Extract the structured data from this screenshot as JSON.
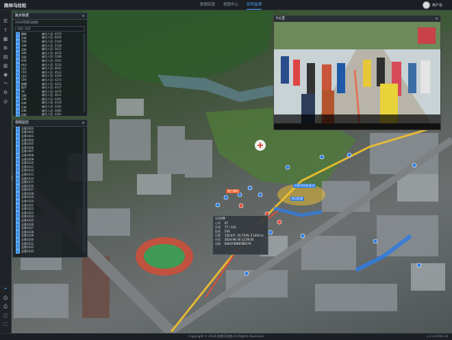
{
  "app": {
    "title": "跑林马拉松"
  },
  "nav": {
    "items": [
      "数据底图",
      "视图中心",
      "实时监测"
    ],
    "active_index": 2
  },
  "user": {
    "name": "用户名"
  },
  "left_toolbar": {
    "icons": [
      "layers-icon",
      "upload-icon",
      "grid-icon",
      "map-icon",
      "doc-icon",
      "chart-icon",
      "camera-icon",
      "route-icon",
      "settings-icon",
      "target-icon"
    ]
  },
  "runner_panel": {
    "title": "跑步数据",
    "subtitle": "2024年跑马拉松",
    "filter_placeholder": "请输入搜索",
    "rows": [
      {
        "name": "最新",
        "value": "编号人员: 4379"
      },
      {
        "name": "24K",
        "value": "编号人员: 6456"
      },
      {
        "name": "15K",
        "value": "编号人员: 2104"
      },
      {
        "name": "10K",
        "value": "编号人员: 3128"
      },
      {
        "name": "20K",
        "value": "编号人员: 3411"
      },
      {
        "name": "30K",
        "value": "编号人员: 4476"
      },
      {
        "name": "35K",
        "value": "编号人员: 1288"
      },
      {
        "name": "42K",
        "value": "编号人员: 3602"
      },
      {
        "name": "终点",
        "value": "编号人员: 3214"
      },
      {
        "name": "CP1",
        "value": "编号人员: 4601"
      },
      {
        "name": "CP2",
        "value": "编号人员: 3512"
      },
      {
        "name": "CP3",
        "value": "编号人员: 3329"
      },
      {
        "name": "CP4",
        "value": "编号人员: 4215"
      },
      {
        "name": "新疆",
        "value": "编号人员: 4231"
      },
      {
        "name": "医疗",
        "value": "编号人员: 4317"
      },
      {
        "name": "2K",
        "value": "编号人员: 3476"
      },
      {
        "name": "10K",
        "value": "编号人员: 3011"
      },
      {
        "name": "13K",
        "value": "编号人员: 4301"
      },
      {
        "name": "20K",
        "value": "编号人员: 4318"
      },
      {
        "name": "23K",
        "value": "编号人员: 3305"
      },
      {
        "name": "44K",
        "value": "编号人员: 4480"
      },
      {
        "name": "50K",
        "value": "编号人员: 4391"
      }
    ]
  },
  "camera_panel": {
    "title": "视频监控",
    "rows": [
      "全景1001",
      "全景1002",
      "全景1003",
      "全景1004",
      "全景1005",
      "全景1006",
      "全景1007",
      "全景1008",
      "全景1009",
      "全景1010",
      "全景1011",
      "全景1012",
      "全景1013",
      "全景1014",
      "全景1015",
      "全景1016",
      "全景1017",
      "全景1018",
      "全景1019",
      "全景1020",
      "全景1021",
      "全景1022",
      "全景1023",
      "全景1024",
      "全景1025",
      "全景1026",
      "全景1027",
      "全景1028",
      "全景1029",
      "全景1030",
      "全景1031",
      "全景1032",
      "全景1033"
    ]
  },
  "video_popup": {
    "title": "5公里"
  },
  "info_popup": {
    "title": "12分钟",
    "rows": [
      {
        "key": "心率",
        "value": "97"
      },
      {
        "key": "步频",
        "value": "77 / 131"
      },
      {
        "key": "配速",
        "value": "554"
      },
      {
        "key": "位置",
        "value": "126.63°, 45.7519, 3.1416 m"
      },
      {
        "key": "时间",
        "value": "2024-06-16 12:29:45"
      },
      {
        "key": "设备",
        "value": "8443748987B6179"
      }
    ]
  },
  "map_labels": [
    {
      "text": "半程马拉线-起点",
      "color": "#2f7de0"
    },
    {
      "text": "施工路段",
      "color": "#e85c2a"
    },
    {
      "text": "终点区域",
      "color": "#2f7de0"
    }
  ],
  "footer": {
    "copyright": "Copyright © 2024 跑林马拉松 All Rights Reserved",
    "version": "v 3.4.2406.14"
  }
}
